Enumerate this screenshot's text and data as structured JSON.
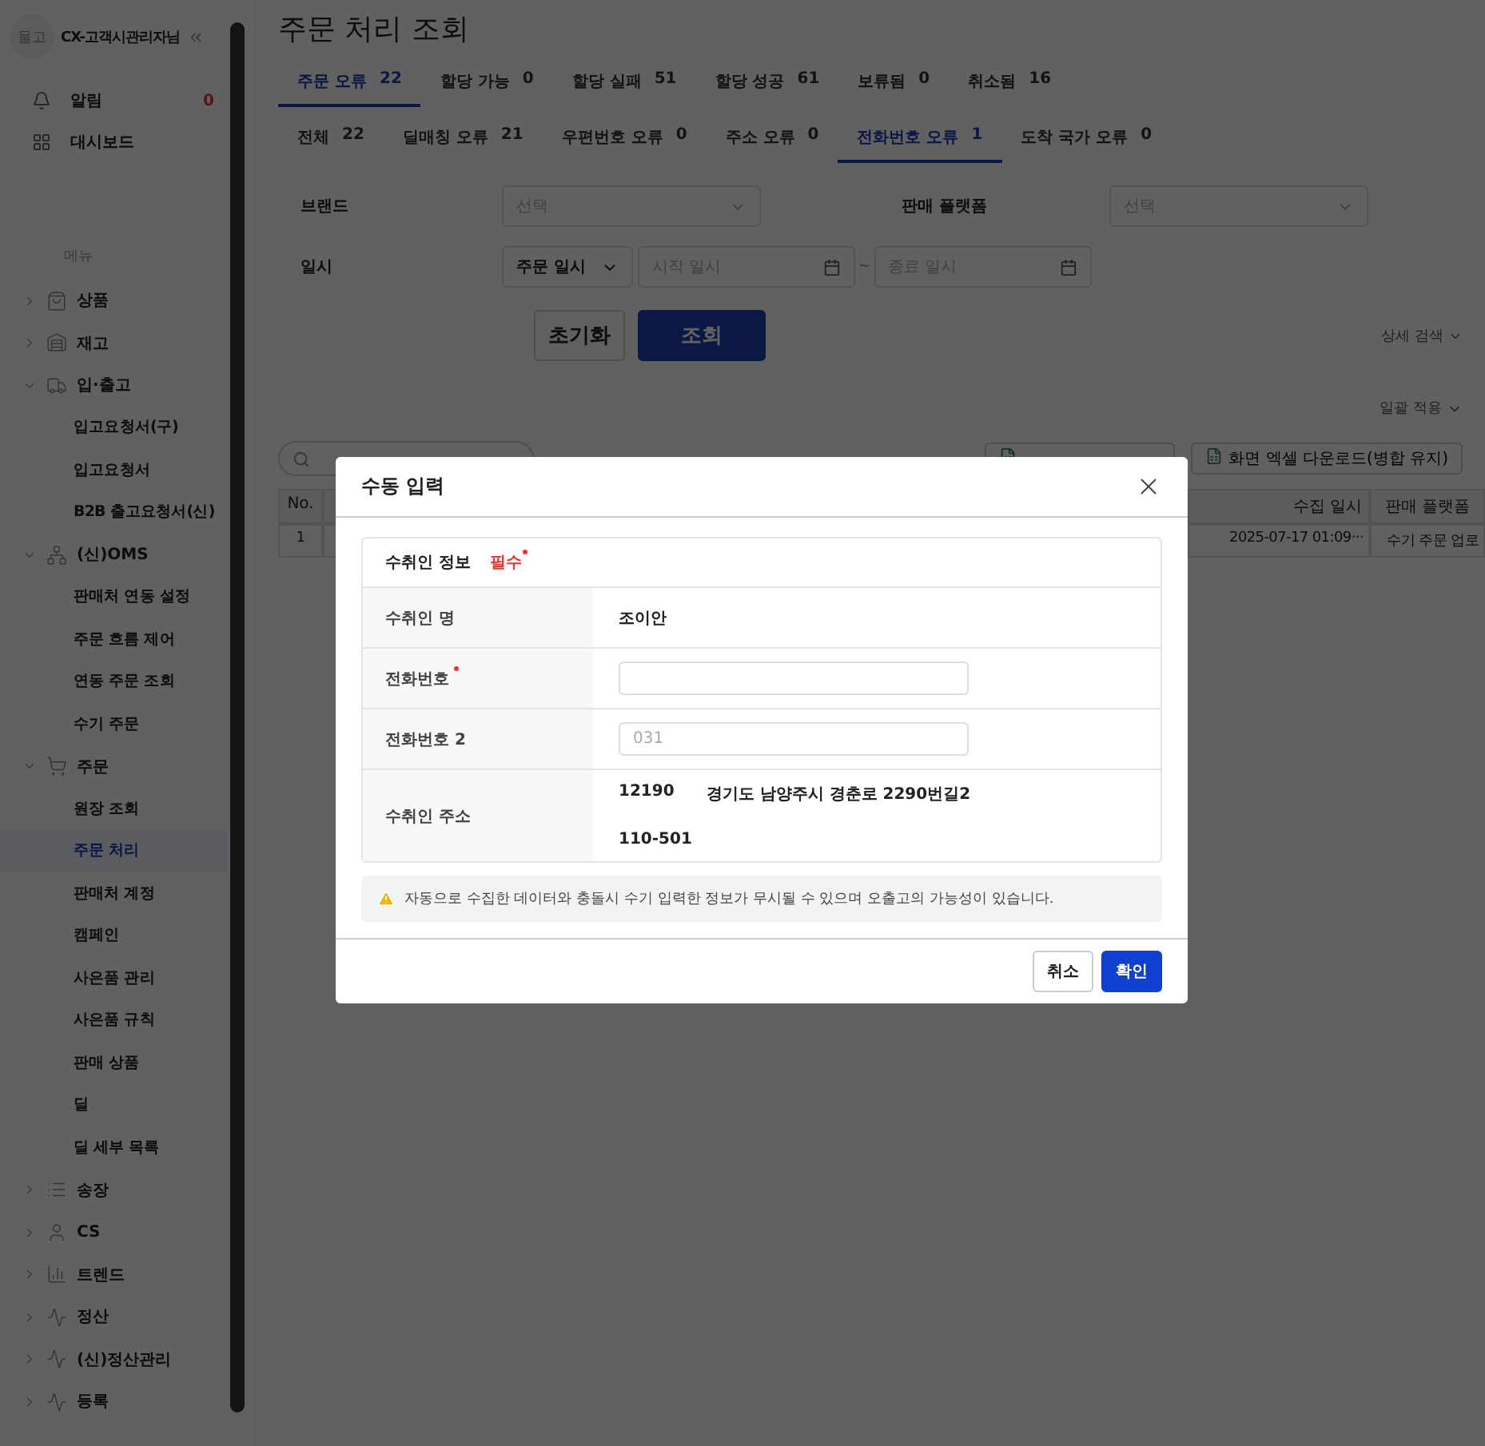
{
  "sidebar": {
    "avatar_text": "물고",
    "user_name": "CX-고객시관리자님",
    "top_items": [
      {
        "label": "알림",
        "badge": "0"
      },
      {
        "label": "대시보드"
      }
    ],
    "menu_label": "메뉴",
    "menu": [
      {
        "label": "상품",
        "expanded": false
      },
      {
        "label": "재고",
        "expanded": false
      },
      {
        "label": "입·출고",
        "expanded": true,
        "children": [
          {
            "label": "입고요청서(구)",
            "selected": false
          },
          {
            "label": "입고요청서",
            "selected": false
          },
          {
            "label": "B2B 출고요청서(신)",
            "selected": false
          }
        ]
      },
      {
        "label": "(신)OMS",
        "expanded": true,
        "children": [
          {
            "label": "판매처 연동 설정",
            "selected": false
          },
          {
            "label": "주문 흐름 제어",
            "selected": false
          },
          {
            "label": "연동 주문 조회",
            "selected": false
          },
          {
            "label": "수기 주문",
            "selected": false
          }
        ]
      },
      {
        "label": "주문",
        "expanded": true,
        "children": [
          {
            "label": "원장 조회",
            "selected": false
          },
          {
            "label": "주문 처리",
            "selected": true
          },
          {
            "label": "판매처 계정",
            "selected": false
          },
          {
            "label": "캠페인",
            "selected": false
          },
          {
            "label": "사은품 관리",
            "selected": false
          },
          {
            "label": "사은품 규칙",
            "selected": false
          },
          {
            "label": "판매 상품",
            "selected": false
          },
          {
            "label": "딜",
            "selected": false
          },
          {
            "label": "딜 세부 목록",
            "selected": false
          }
        ]
      },
      {
        "label": "송장",
        "expanded": false
      },
      {
        "label": "CS",
        "expanded": false
      },
      {
        "label": "트렌드",
        "expanded": false
      },
      {
        "label": "정산",
        "expanded": false
      },
      {
        "label": "(신)정산관리",
        "expanded": false
      },
      {
        "label": "등록",
        "expanded": false
      }
    ]
  },
  "page": {
    "title": "주문 처리 조회",
    "status_tabs": [
      {
        "label": "주문 오류",
        "count": "22",
        "selected": true
      },
      {
        "label": "할당 가능",
        "count": "0",
        "selected": false
      },
      {
        "label": "할당 실패",
        "count": "51",
        "selected": false
      },
      {
        "label": "할당 성공",
        "count": "61",
        "selected": false
      },
      {
        "label": "보류됨",
        "count": "0",
        "selected": false
      },
      {
        "label": "취소됨",
        "count": "16",
        "selected": false
      }
    ],
    "error_tabs": [
      {
        "label": "전체",
        "count": "22",
        "selected": false
      },
      {
        "label": "딜매칭 오류",
        "count": "21",
        "selected": false
      },
      {
        "label": "우편번호 오류",
        "count": "0",
        "selected": false
      },
      {
        "label": "주소 오류",
        "count": "0",
        "selected": false
      },
      {
        "label": "전화번호 오류",
        "count": "1",
        "selected": true
      },
      {
        "label": "도착 국가 오류",
        "count": "0",
        "selected": false
      }
    ],
    "filters": {
      "brand": {
        "label": "브랜드",
        "placeholder": "선택"
      },
      "platform": {
        "label": "판매 플랫폼",
        "placeholder": "선택"
      },
      "date": {
        "label": "일시",
        "type_value": "주문 일시",
        "start_placeholder": "시작 일시",
        "separator": "~",
        "end_placeholder": "종료 일시"
      }
    },
    "reset_button": "초기화",
    "search_button": "조회",
    "detail_search": "상세 검색",
    "bulk_apply": "일괄 적용",
    "toolbar": {
      "excel_merged_button": "화면 엑셀 다운로드(병합 유지)"
    },
    "table": {
      "columns": [
        "No.",
        "수집 일시",
        "판매 플랫폼"
      ],
      "rows": [
        [
          "1",
          "2025-07-17 01:09···",
          "수기 주문 업로"
        ]
      ]
    }
  },
  "modal": {
    "title": "수동 입력",
    "section_title": "수취인 정보",
    "required_label": "필수",
    "rows": [
      {
        "kind": "text",
        "label": "수취인 명",
        "required": false,
        "value": "조이안"
      },
      {
        "kind": "input",
        "label": "전화번호",
        "required": true
      },
      {
        "kind": "input",
        "label": "전화번호 2",
        "required": false,
        "placeholder": "031"
      },
      {
        "kind": "address",
        "label": "수취인 주소",
        "required": false,
        "postcode": "12190",
        "address": "경기도 남양주시 경춘로 2290번길2",
        "detail": "110-501"
      }
    ],
    "warning": "자동으로 수집한 데이터와 충돌시 수기 입력한 정보가 무시될 수 있으며 오출고의 가능성이 있습니다.",
    "cancel_button": "취소",
    "confirm_button": "확인"
  }
}
